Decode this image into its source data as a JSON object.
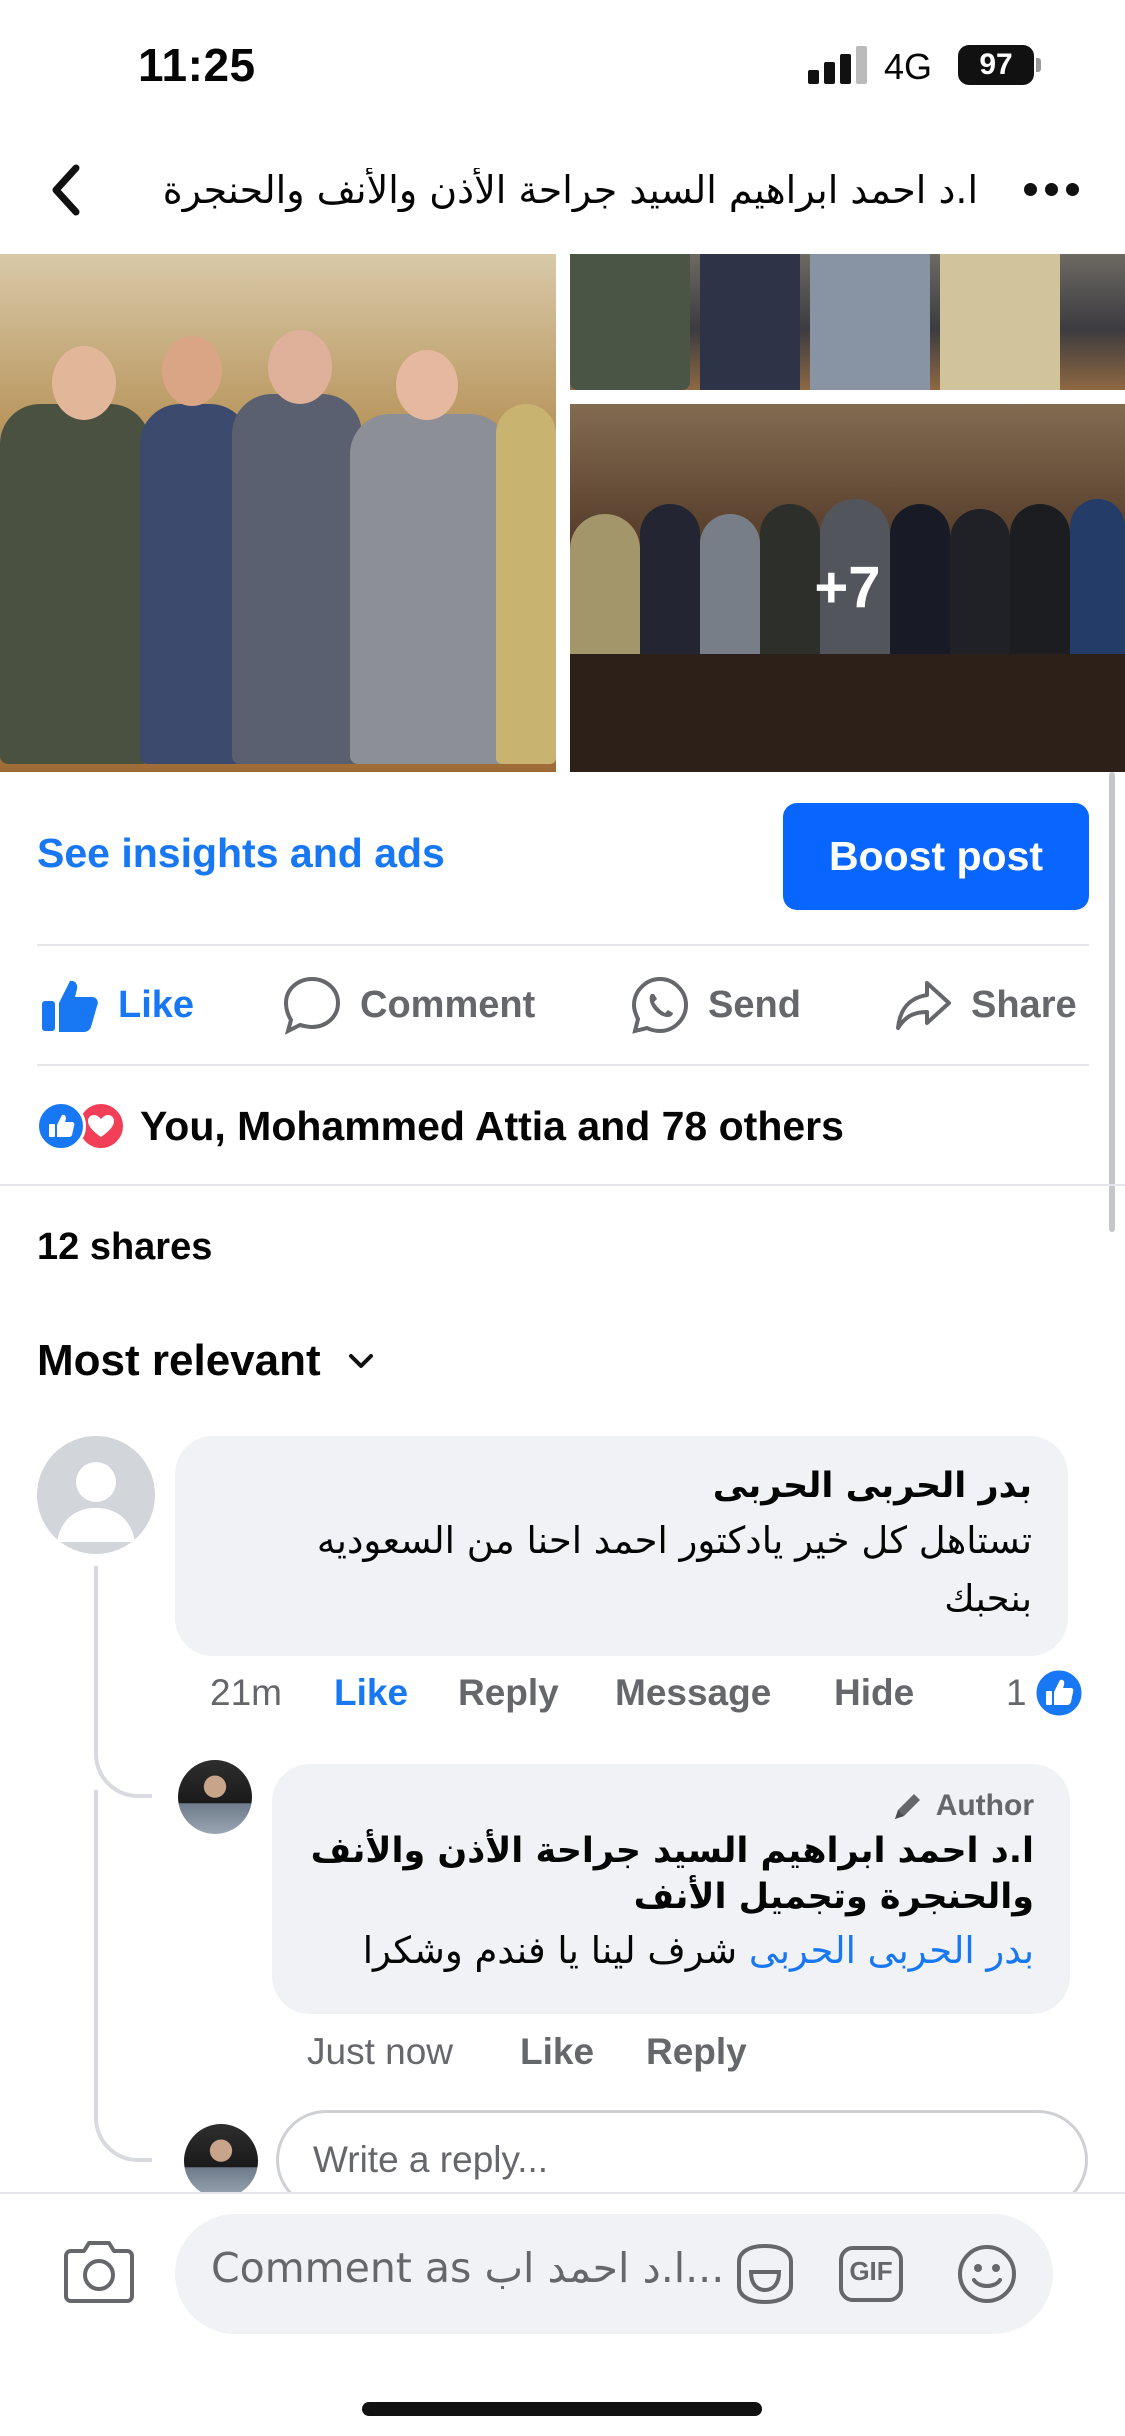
{
  "status_bar": {
    "time": "11:25",
    "network": "4G",
    "battery": "97"
  },
  "header": {
    "title": "ا.د احمد ابراهيم السيد جراحة الأذن والأنف والحنجرة وتجميل الأنف"
  },
  "photos": {
    "more_count": "+7"
  },
  "insights": {
    "link": "See insights and ads",
    "boost": "Boost post"
  },
  "actions": {
    "like": "Like",
    "comment": "Comment",
    "send": "Send",
    "share": "Share"
  },
  "colors": {
    "facebook_blue": "#1877f2",
    "boost_blue": "#0866ff",
    "love_red": "#f33e58"
  },
  "reactions": {
    "text": "You, Mohammed Attia and 78 others"
  },
  "shares": "12 shares",
  "sort": {
    "label": "Most relevant"
  },
  "comments": [
    {
      "author": "بدر الحربى الحربى",
      "text_line1": "تستاهل كل خير يادكتور احمد احنا من السعوديه",
      "text_line2": "بنحبك",
      "time": "21m",
      "like": "Like",
      "reply": "Reply",
      "message": "Message",
      "hide": "Hide",
      "like_count": "1"
    }
  ],
  "reply": {
    "badge": "Author",
    "author_line1": "ا.د احمد ابراهيم السيد جراحة الأذن والأنف",
    "author_line2": "والحنجرة وتجميل الأنف",
    "mention": "بدر الحربى الحربى",
    "text": "شرف لينا يا فندم وشكرا",
    "time": "Just now",
    "like": "Like",
    "reply": "Reply"
  },
  "reply_input": {
    "placeholder": "Write a reply..."
  },
  "composer": {
    "placeholder": "Comment as ا.د احمد اب...",
    "gif": "GIF"
  }
}
